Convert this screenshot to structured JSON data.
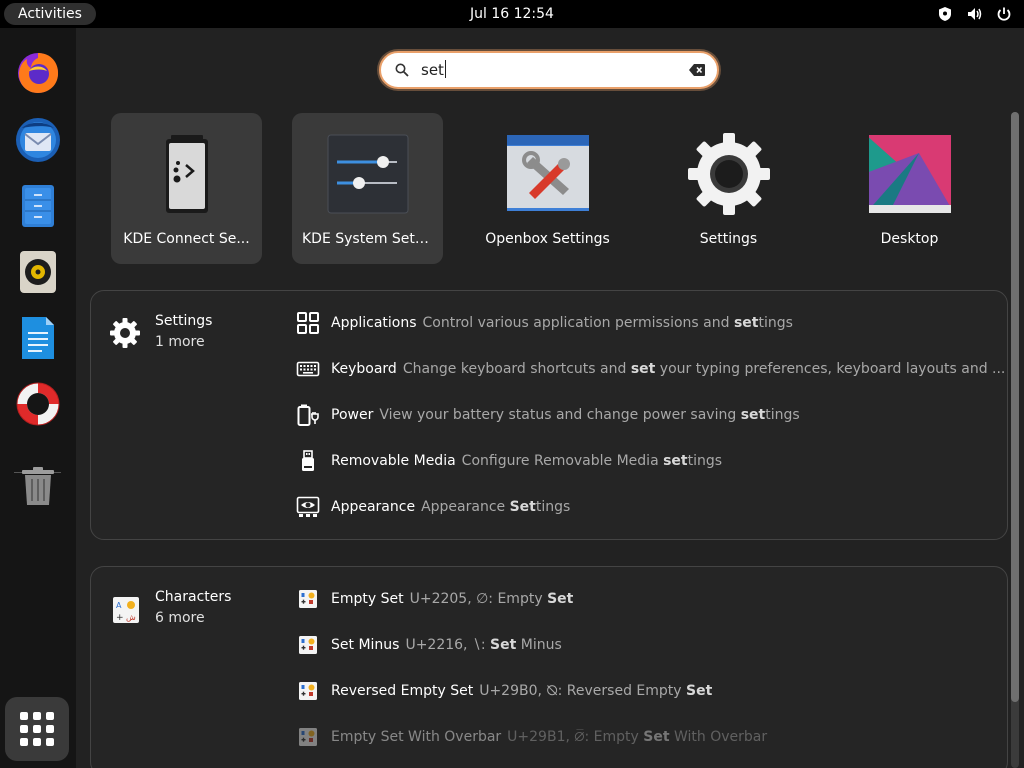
{
  "topbar": {
    "activities": "Activities",
    "clock": "Jul 16  12:54",
    "tray_icons": [
      "shield-icon",
      "volume-icon",
      "power-icon"
    ]
  },
  "dash": {
    "items": [
      "firefox",
      "thunderbird",
      "files",
      "rhythmbox",
      "writer",
      "help",
      "trash"
    ],
    "show_apps": "show-applications"
  },
  "search": {
    "query": "set",
    "clear_icon": "backspace-clear-icon"
  },
  "apps": [
    {
      "label": "KDE Connect Se...",
      "highlighted": true
    },
    {
      "label": "KDE System Sett...",
      "highlighted": true
    },
    {
      "label": "Openbox Settings",
      "highlighted": false
    },
    {
      "label": "Settings",
      "highlighted": false
    },
    {
      "label": "Desktop",
      "highlighted": false
    }
  ],
  "settings_provider": {
    "name": "Settings",
    "more": "1 more",
    "results": [
      {
        "title": "Applications",
        "desc_pre": "Control various application permissions and ",
        "desc_bold": "set",
        "desc_post": "tings",
        "icon": "apps-grid-icon"
      },
      {
        "title": "Keyboard",
        "desc_pre": "Change keyboard shortcuts and ",
        "desc_bold": "set",
        "desc_post": " your typing preferences, keyboard layouts and ...",
        "icon": "keyboard-icon"
      },
      {
        "title": "Power",
        "desc_pre": "View your battery status and change power saving ",
        "desc_bold": "set",
        "desc_post": "tings",
        "icon": "battery-power-icon"
      },
      {
        "title": "Removable Media",
        "desc_pre": "Configure Removable Media ",
        "desc_bold": "set",
        "desc_post": "tings",
        "icon": "usb-drive-icon"
      },
      {
        "title": "Appearance",
        "desc_pre": "Appearance ",
        "desc_bold": "Set",
        "desc_post": "tings",
        "icon": "appearance-icon"
      }
    ]
  },
  "characters_provider": {
    "name": "Characters",
    "more": "6 more",
    "results": [
      {
        "title": "Empty Set",
        "desc_pre": "U+2205, ∅: Empty ",
        "desc_bold": "Set",
        "desc_post": ""
      },
      {
        "title": "Set Minus",
        "desc_pre": "U+2216, ∖: ",
        "desc_bold": "Set",
        "desc_post": " Minus"
      },
      {
        "title": "Reversed Empty Set",
        "desc_pre": "U+29B0, ⦰: Reversed Empty ",
        "desc_bold": "Set",
        "desc_post": ""
      },
      {
        "title": "Empty Set With Overbar",
        "desc_pre": "U+29B1, ⦱: Empty ",
        "desc_bold": "Set",
        "desc_post": " With Overbar"
      }
    ]
  }
}
